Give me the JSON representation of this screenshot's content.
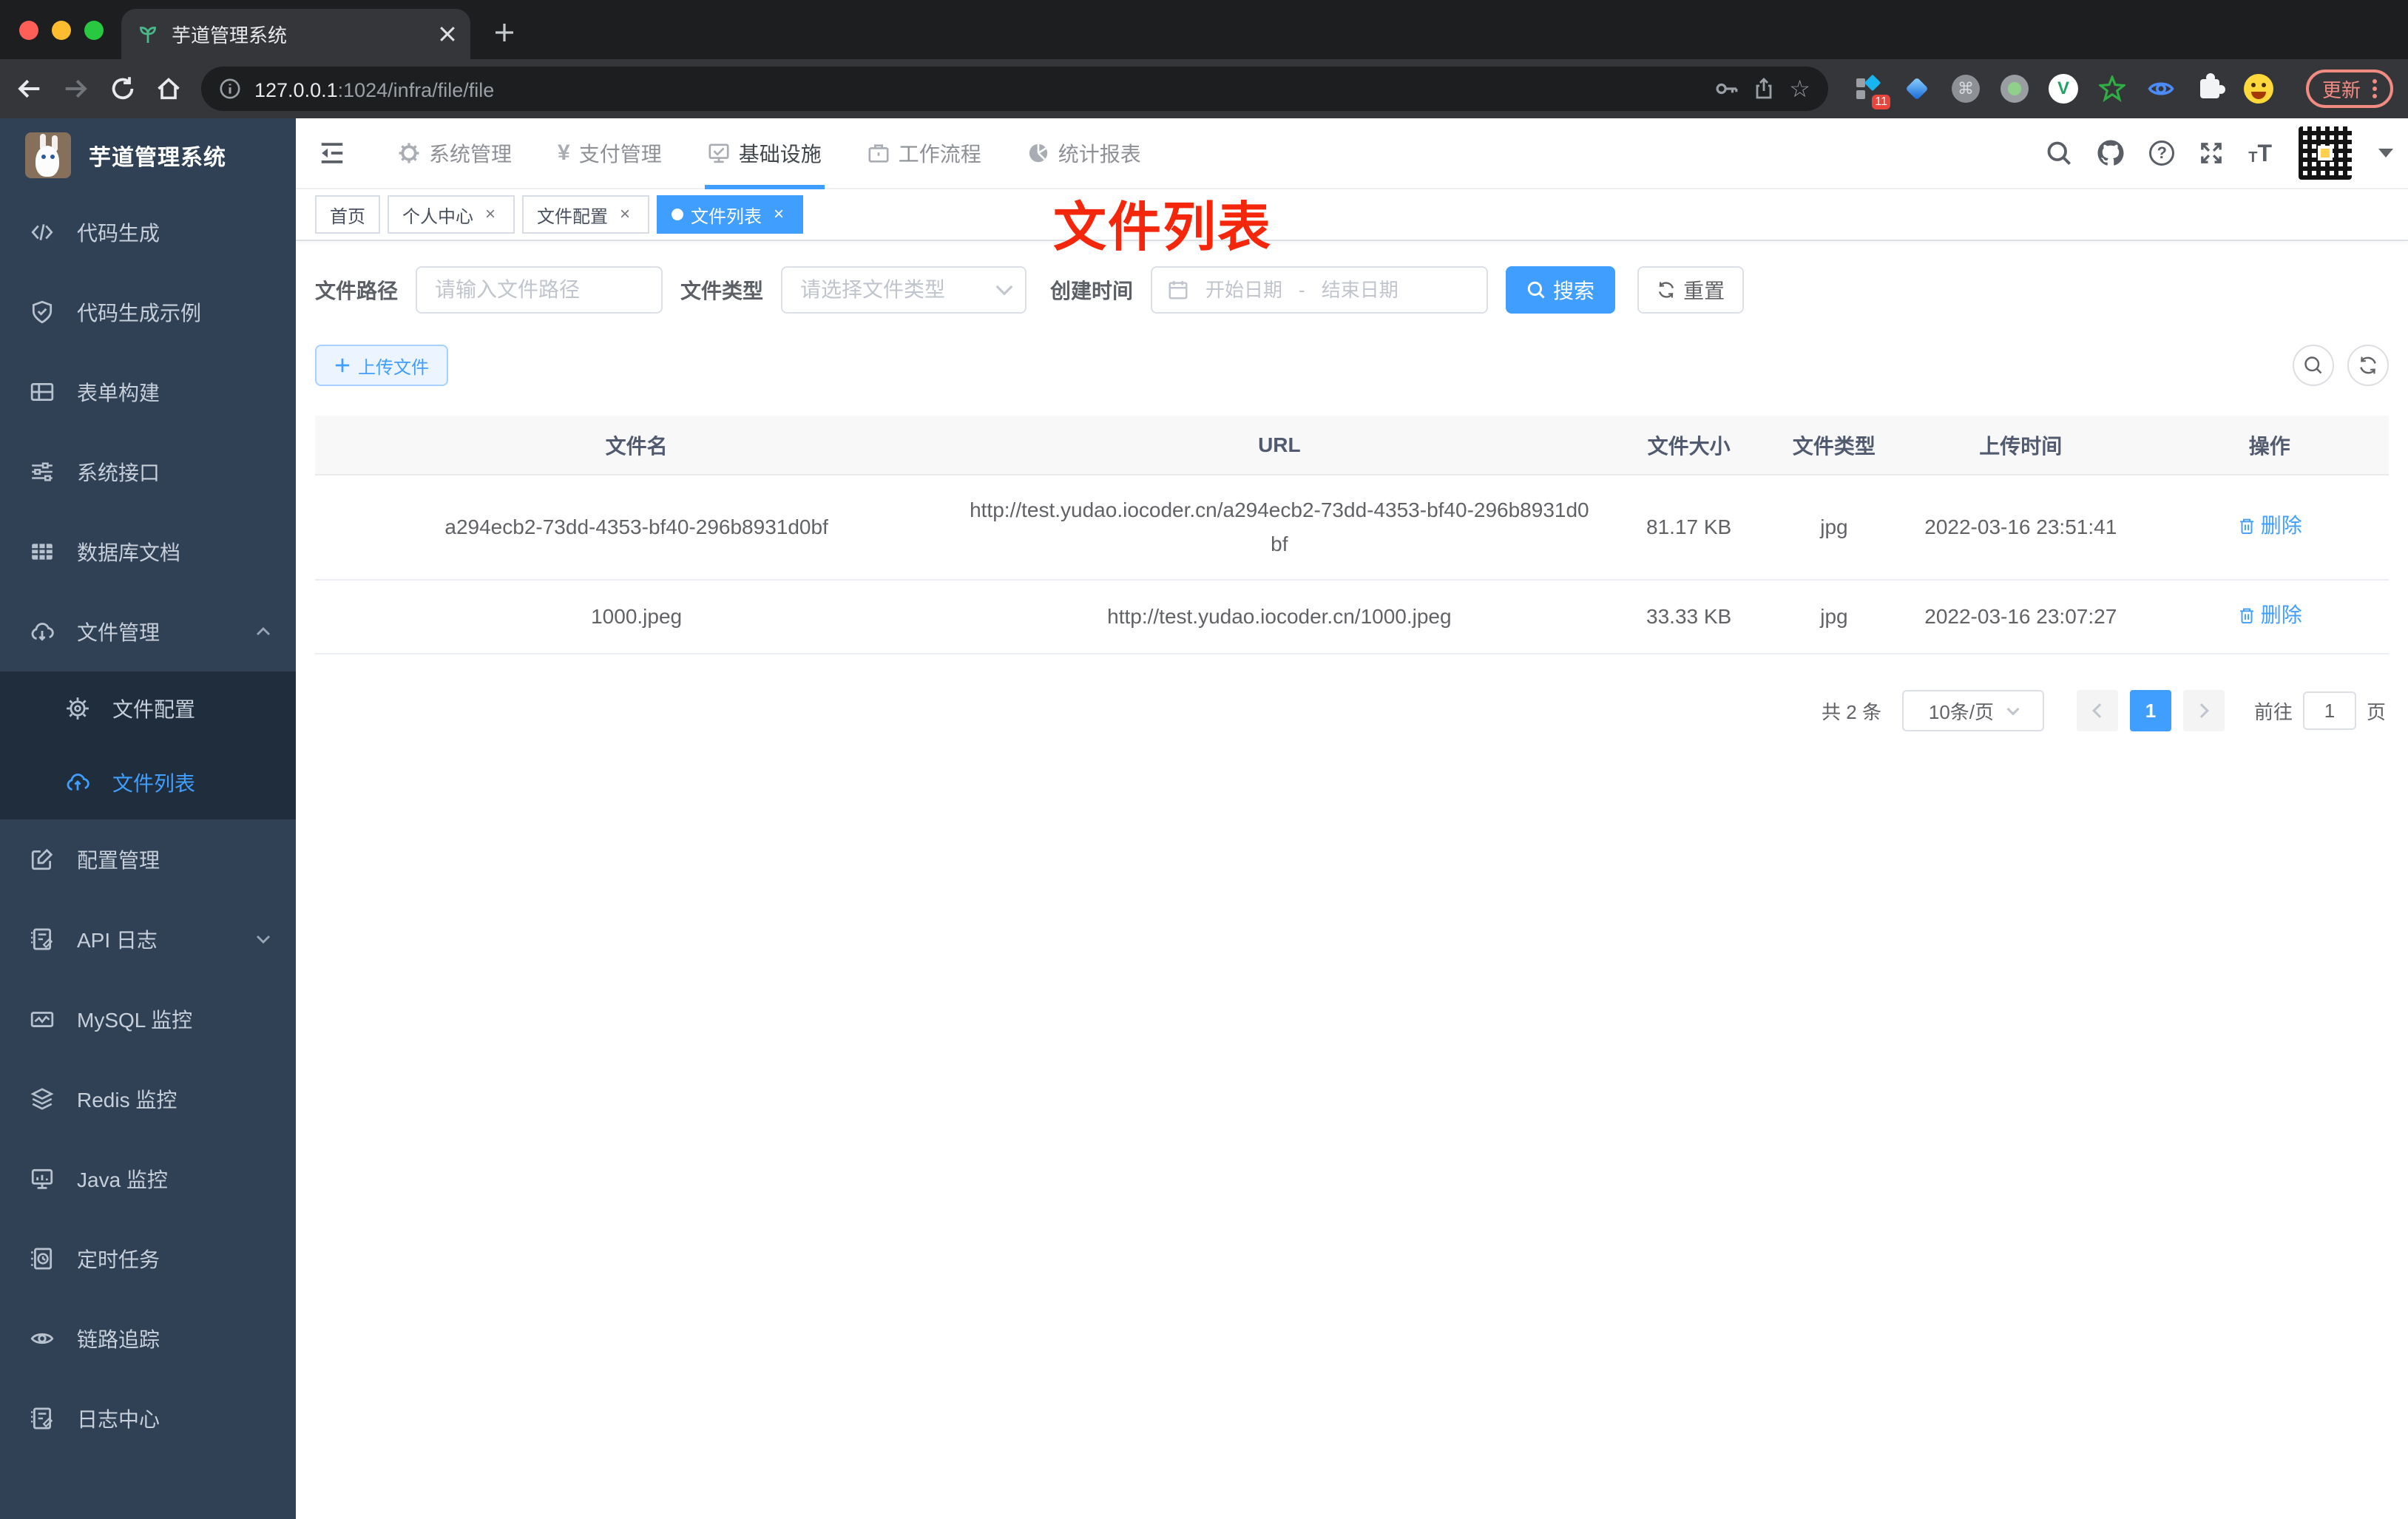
{
  "browser": {
    "tab_title": "芋道管理系统",
    "url_host": "127.0.0.1",
    "url_path": ":1024/infra/file/file",
    "extensions_badge": "11",
    "update_button": "更新"
  },
  "sidebar": {
    "app_title": "芋道管理系统",
    "items": [
      {
        "label": "代码生成"
      },
      {
        "label": "代码生成示例"
      },
      {
        "label": "表单构建"
      },
      {
        "label": "系统接口"
      },
      {
        "label": "数据库文档"
      },
      {
        "label": "文件管理"
      },
      {
        "label": "配置管理"
      },
      {
        "label": "API 日志"
      },
      {
        "label": "MySQL 监控"
      },
      {
        "label": "Redis 监控"
      },
      {
        "label": "Java 监控"
      },
      {
        "label": "定时任务"
      },
      {
        "label": "链路追踪"
      },
      {
        "label": "日志中心"
      }
    ],
    "submenu": [
      {
        "label": "文件配置"
      },
      {
        "label": "文件列表"
      }
    ]
  },
  "topnav": {
    "items": [
      {
        "label": "系统管理"
      },
      {
        "label": "支付管理"
      },
      {
        "label": "基础设施"
      },
      {
        "label": "工作流程"
      },
      {
        "label": "统计报表"
      }
    ]
  },
  "tags": {
    "close_glyph": "×",
    "items": [
      {
        "label": "首页"
      },
      {
        "label": "个人中心"
      },
      {
        "label": "文件配置"
      },
      {
        "label": "文件列表"
      }
    ]
  },
  "annotation": {
    "text": "文件列表",
    "color": "#f4270c"
  },
  "filters": {
    "path_label": "文件路径",
    "path_placeholder": "请输入文件路径",
    "type_label": "文件类型",
    "type_placeholder": "请选择文件类型",
    "time_label": "创建时间",
    "start_placeholder": "开始日期",
    "range_separator": "-",
    "end_placeholder": "结束日期",
    "search_button": "搜索",
    "reset_button": "重置"
  },
  "toolbar": {
    "upload_label": "上传文件"
  },
  "table": {
    "headers": [
      "文件名",
      "URL",
      "文件大小",
      "文件类型",
      "上传时间",
      "操作"
    ],
    "rows": [
      {
        "name": "a294ecb2-73dd-4353-bf40-296b8931d0bf",
        "url": "http://test.yudao.iocoder.cn/a294ecb2-73dd-4353-bf40-296b8931d0bf",
        "size": "81.17 KB",
        "type": "jpg",
        "time": "2022-03-16 23:51:41",
        "action": "删除"
      },
      {
        "name": "1000.jpeg",
        "url": "http://test.yudao.iocoder.cn/1000.jpeg",
        "size": "33.33 KB",
        "type": "jpg",
        "time": "2022-03-16 23:07:27",
        "action": "删除"
      }
    ]
  },
  "pagination": {
    "total_text": "共 2 条",
    "page_size": "10条/页",
    "current_page": "1",
    "goto_label": "前往",
    "goto_value": "1",
    "page_suffix": "页"
  },
  "colors": {
    "accent": "#409eff",
    "sidebar_bg": "#304156",
    "submenu_bg": "#1f2d3d",
    "annotation_red": "#f4270c"
  }
}
